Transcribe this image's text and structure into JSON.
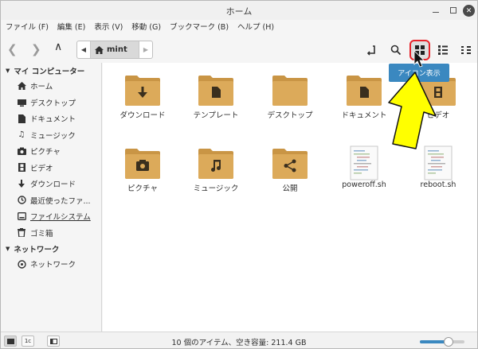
{
  "window": {
    "title": "ホーム"
  },
  "menubar": {
    "items": [
      "ファイル (F)",
      "編集 (E)",
      "表示 (V)",
      "移動 (G)",
      "ブックマーク (B)",
      "ヘルプ (H)"
    ]
  },
  "toolbar": {
    "path_segment": "mint",
    "tooltip": "アイコン表示"
  },
  "sidebar": {
    "sections": [
      {
        "title": "マイ コンピューター",
        "items": [
          {
            "label": "ホーム",
            "icon": "home-icon"
          },
          {
            "label": "デスクトップ",
            "icon": "desktop-icon"
          },
          {
            "label": "ドキュメント",
            "icon": "document-icon"
          },
          {
            "label": "ミュージック",
            "icon": "music-icon"
          },
          {
            "label": "ピクチャ",
            "icon": "camera-icon"
          },
          {
            "label": "ビデオ",
            "icon": "film-icon"
          },
          {
            "label": "ダウンロード",
            "icon": "download-icon"
          },
          {
            "label": "最近使ったファ...",
            "icon": "clock-icon"
          },
          {
            "label": "ファイルシステム",
            "icon": "drive-icon"
          },
          {
            "label": "ゴミ箱",
            "icon": "trash-icon"
          }
        ]
      },
      {
        "title": "ネットワーク",
        "items": [
          {
            "label": "ネットワーク",
            "icon": "network-icon"
          }
        ]
      }
    ]
  },
  "files": [
    {
      "name": "ダウンロード",
      "type": "folder",
      "emblem": "download"
    },
    {
      "name": "テンプレート",
      "type": "folder",
      "emblem": "template"
    },
    {
      "name": "デスクトップ",
      "type": "folder",
      "emblem": "none"
    },
    {
      "name": "ドキュメント",
      "type": "folder",
      "emblem": "document"
    },
    {
      "name": "ビデオ",
      "type": "folder",
      "emblem": "film"
    },
    {
      "name": "ピクチャ",
      "type": "folder",
      "emblem": "camera"
    },
    {
      "name": "ミュージック",
      "type": "folder",
      "emblem": "music"
    },
    {
      "name": "公開",
      "type": "folder",
      "emblem": "share"
    },
    {
      "name": "poweroff.sh",
      "type": "script"
    },
    {
      "name": "reboot.sh",
      "type": "script"
    }
  ],
  "statusbar": {
    "text": "10 個のアイテム、空き容量: 211.4 GB",
    "zoom_level": 0.65
  },
  "colors": {
    "folder": "#dcaa5a",
    "folder_tab": "#c99545",
    "accent": "#3a88c0",
    "highlight_border": "#e8242b",
    "arrow": "#ffff00"
  }
}
